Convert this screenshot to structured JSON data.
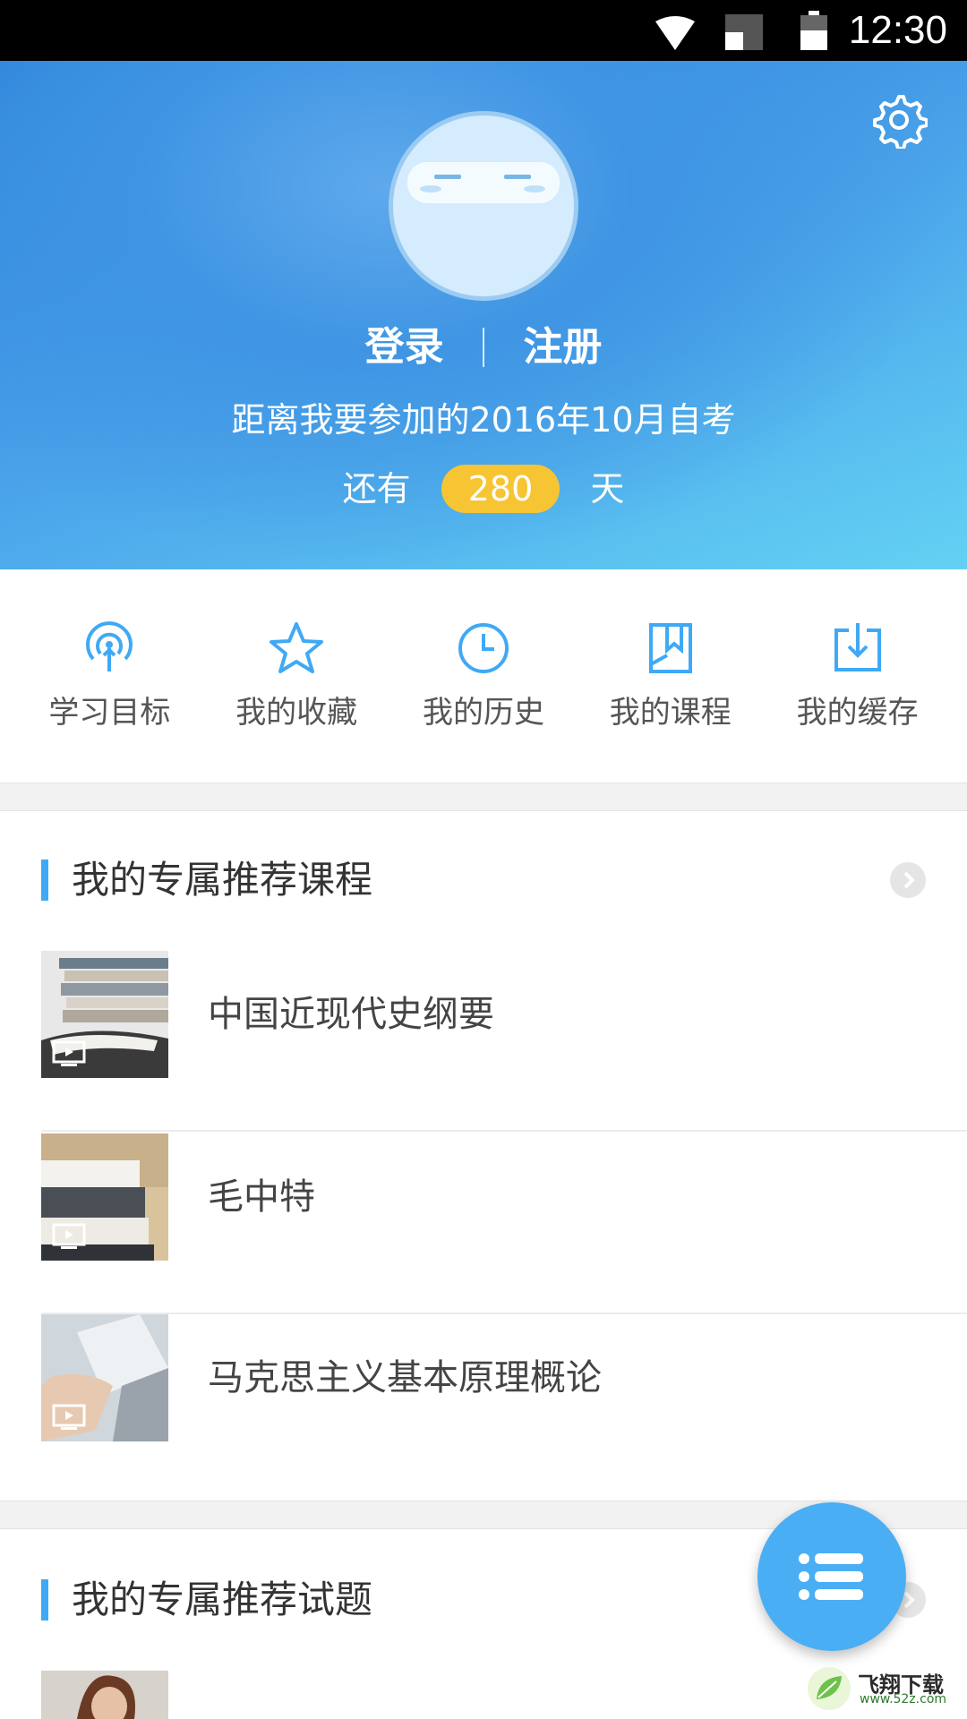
{
  "status_bar": {
    "time": "12:30"
  },
  "header": {
    "login_label": "登录",
    "register_label": "注册",
    "exam_text": "距离我要参加的2016年10月自考",
    "days_prefix": "还有",
    "days_count": "280",
    "days_suffix": "天"
  },
  "quick_menu": [
    {
      "label": "学习目标",
      "icon": "target-broadcast-icon"
    },
    {
      "label": "我的收藏",
      "icon": "star-icon"
    },
    {
      "label": "我的历史",
      "icon": "clock-icon"
    },
    {
      "label": "我的课程",
      "icon": "bookmark-book-icon"
    },
    {
      "label": "我的缓存",
      "icon": "download-icon"
    }
  ],
  "recommended_courses": {
    "title": "我的专属推荐课程",
    "items": [
      {
        "title": "中国近现代史纲要"
      },
      {
        "title": "毛中特"
      },
      {
        "title": "马克思主义基本原理概论"
      }
    ]
  },
  "recommended_questions": {
    "title": "我的专属推荐试题"
  },
  "watermark": {
    "text": "飞翔下载",
    "url": "www.52z.com"
  },
  "colors": {
    "accent": "#3fa9f5",
    "badge": "#f7c433",
    "fab": "#4aaef4"
  }
}
